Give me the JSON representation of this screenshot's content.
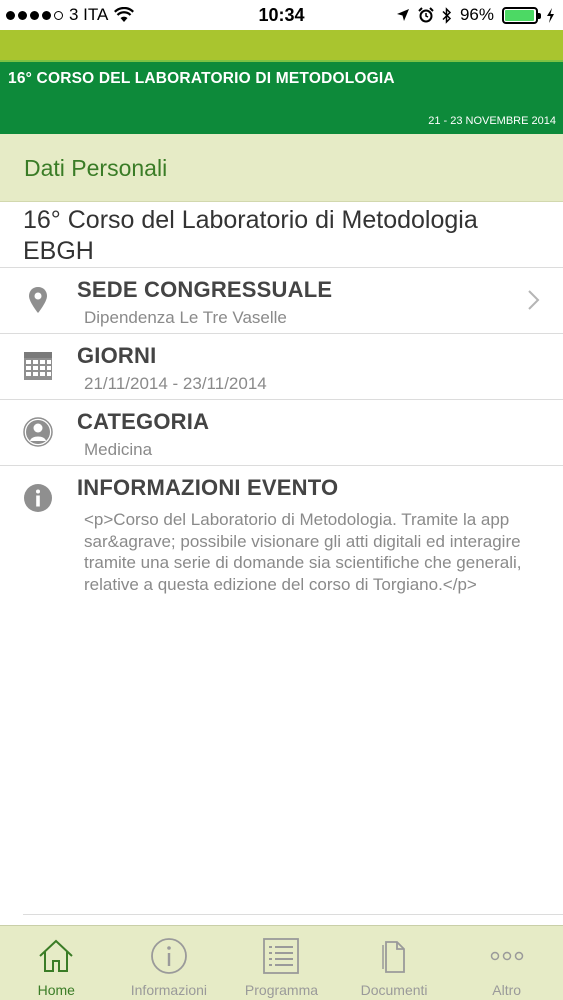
{
  "status_bar": {
    "carrier": "3 ITA",
    "time": "10:34",
    "battery": "96%",
    "battery_level": 0.96
  },
  "banner": {
    "title": "16° CORSO DEL LABORATORIO DI METODOLOGIA",
    "dates": "21 - 23 NOVEMBRE 2014"
  },
  "section": {
    "title": "Dati Personali"
  },
  "event": {
    "title": "16° Corso del Laboratorio di Metodologia EBGH"
  },
  "rows": [
    {
      "label": "SEDE CONGRESSUALE",
      "value": "Dipendenza Le Tre Vaselle",
      "icon": "location-pin-icon"
    },
    {
      "label": "GIORNI",
      "value": "21/11/2014 - 23/11/2014",
      "icon": "calendar-icon"
    },
    {
      "label": "CATEGORIA",
      "value": "Medicina",
      "icon": "person-icon"
    },
    {
      "label": "INFORMAZIONI EVENTO",
      "value": "<p>Corso del Laboratorio di Metodologia. Tramite la app sar&agrave; possibile visionare gli atti digitali ed interagire tramite una serie di domande sia scientifiche che generali, relative a questa edizione del corso di Torgiano.</p>",
      "icon": "info-icon"
    }
  ],
  "tabs": [
    {
      "label": "Home",
      "icon": "home-icon",
      "active": true
    },
    {
      "label": "Informazioni",
      "icon": "info-circle-icon",
      "active": false
    },
    {
      "label": "Programma",
      "icon": "list-icon",
      "active": false
    },
    {
      "label": "Documenti",
      "icon": "document-icon",
      "active": false
    },
    {
      "label": "Altro",
      "icon": "more-icon",
      "active": false
    }
  ],
  "colors": {
    "lime": "#a9c52f",
    "banner_green": "#0d8a3a",
    "section_bg": "#e6ebc6",
    "accent_green": "#3a7c26"
  }
}
